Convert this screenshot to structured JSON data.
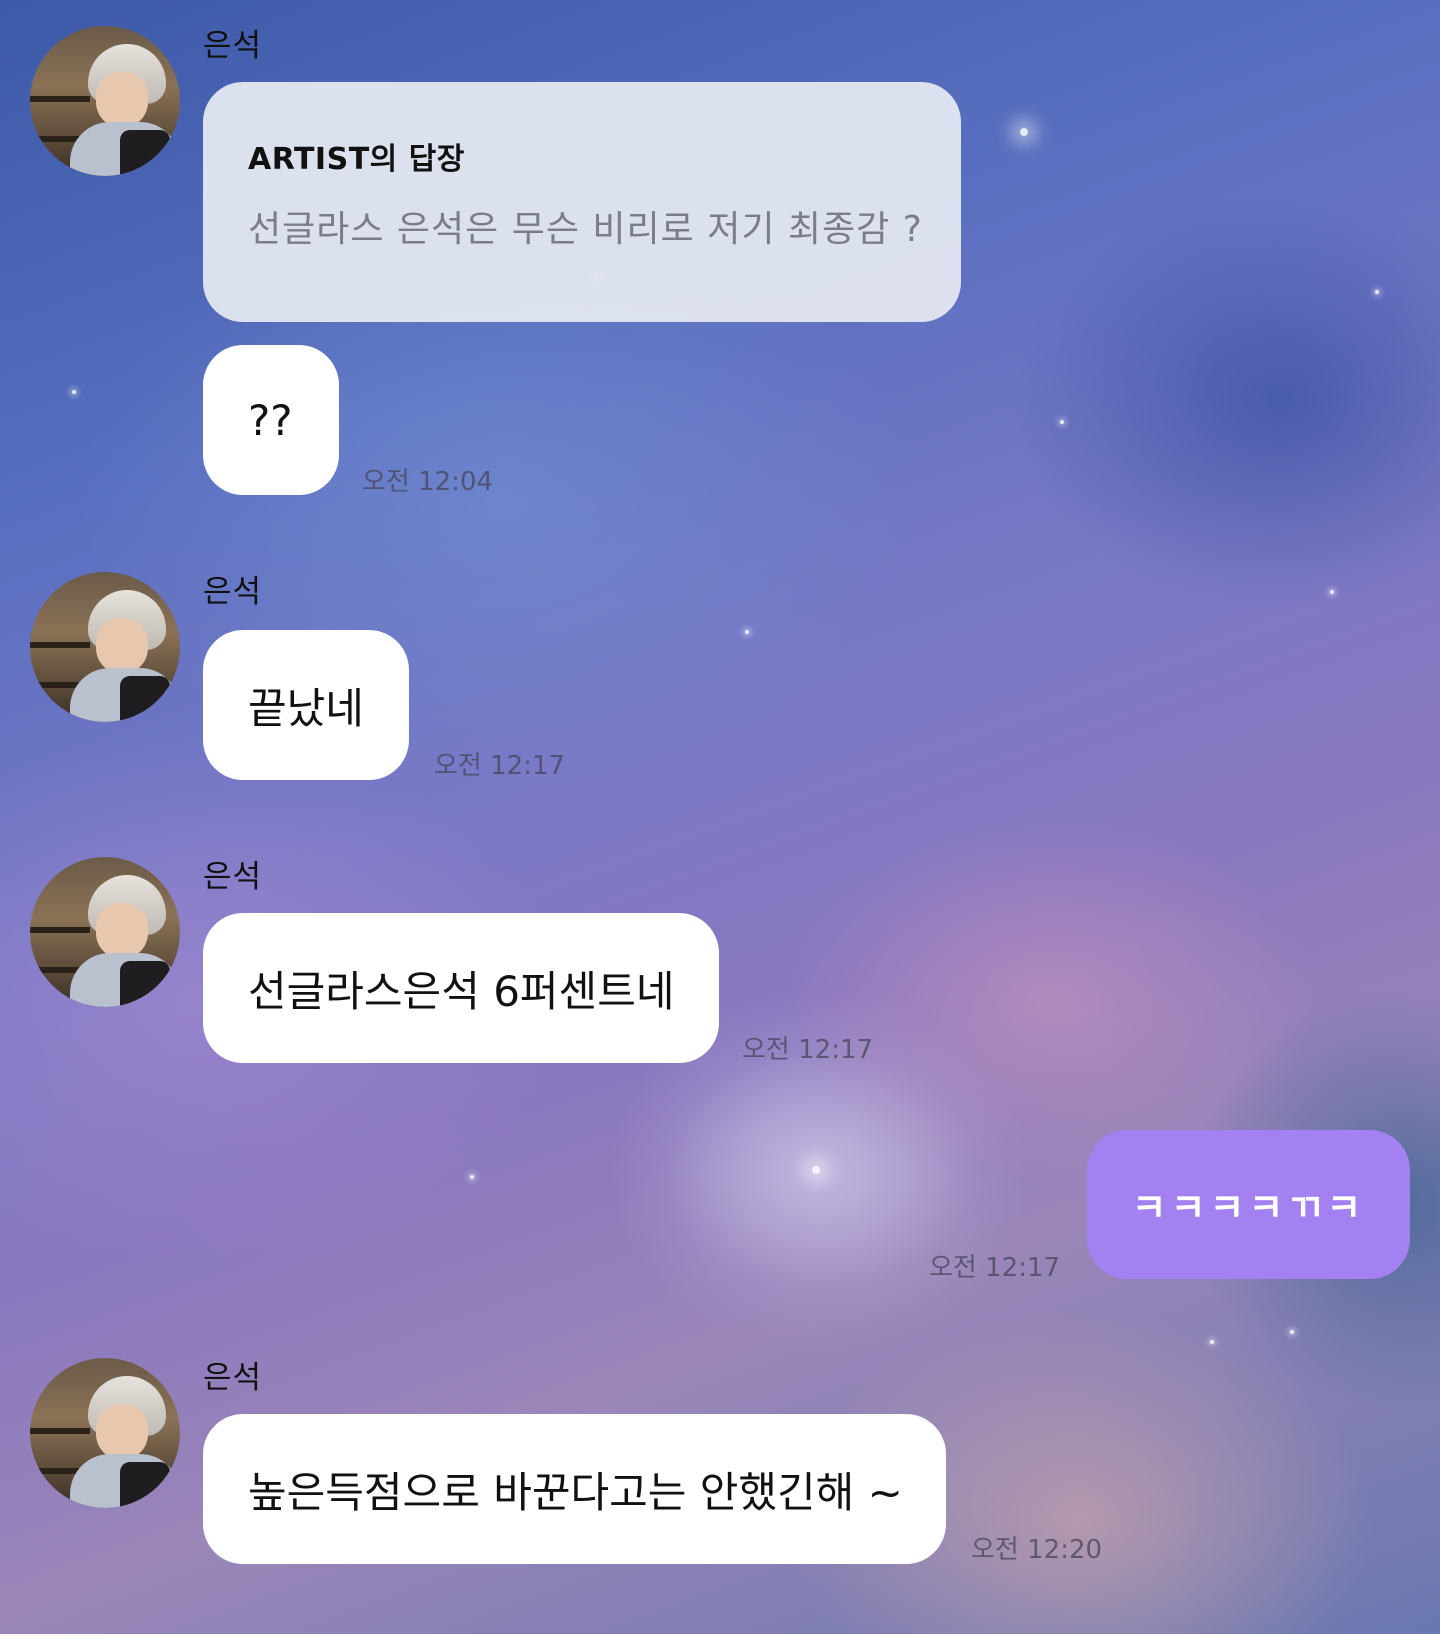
{
  "chat": {
    "messages": [
      {
        "sender": "은석",
        "reply_title": "ARTIST의 답장",
        "reply_text": "선글라스 은석은 무슨 비리로 저기 최종감 ?",
        "text": "??",
        "time": "오전 12:04"
      },
      {
        "sender": "은석",
        "text": "끝났네",
        "time": "오전 12:17"
      },
      {
        "sender": "은석",
        "text": "선글라스은석 6퍼센트네",
        "time": "오전 12:17"
      },
      {
        "mine": true,
        "text": "ㅋㅋㅋㅋㄲㅋ",
        "time": "오전 12:17"
      },
      {
        "sender": "은석",
        "text": "높은득점으로 바꾼다고는 안했긴해 ~",
        "time": "오전 12:20"
      }
    ]
  },
  "colors": {
    "my_bubble": "#a381f0",
    "their_bubble": "#ffffff",
    "reply_bubble": "#e2e6f0"
  }
}
